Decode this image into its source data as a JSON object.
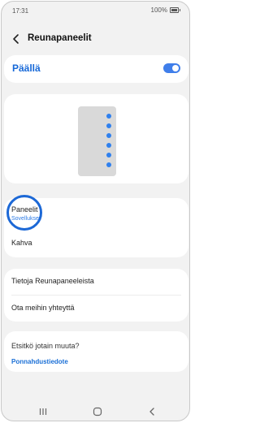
{
  "status": {
    "time": "17:31",
    "battery": "100%"
  },
  "header": {
    "title": "Reunapaneelit"
  },
  "toggle": {
    "label": "Päällä",
    "on": true
  },
  "preview": {
    "dot_count": 6
  },
  "settings": {
    "panels_title": "Paneelit",
    "panels_sub": "Sovellukset",
    "handle_title": "Kahva"
  },
  "info": {
    "about": "Tietoja Reunapaneeleista",
    "contact": "Ota meihin yhteyttä"
  },
  "help": {
    "title": "Etsitkö jotain muuta?",
    "link": "Ponnahdustiedote"
  },
  "colors": {
    "accent": "#2f80ee",
    "highlight": "#1c68d6"
  },
  "icons": {
    "back": "chevron-left-icon",
    "recents": "recents-icon",
    "home": "home-icon",
    "nav_back": "nav-back-icon"
  }
}
